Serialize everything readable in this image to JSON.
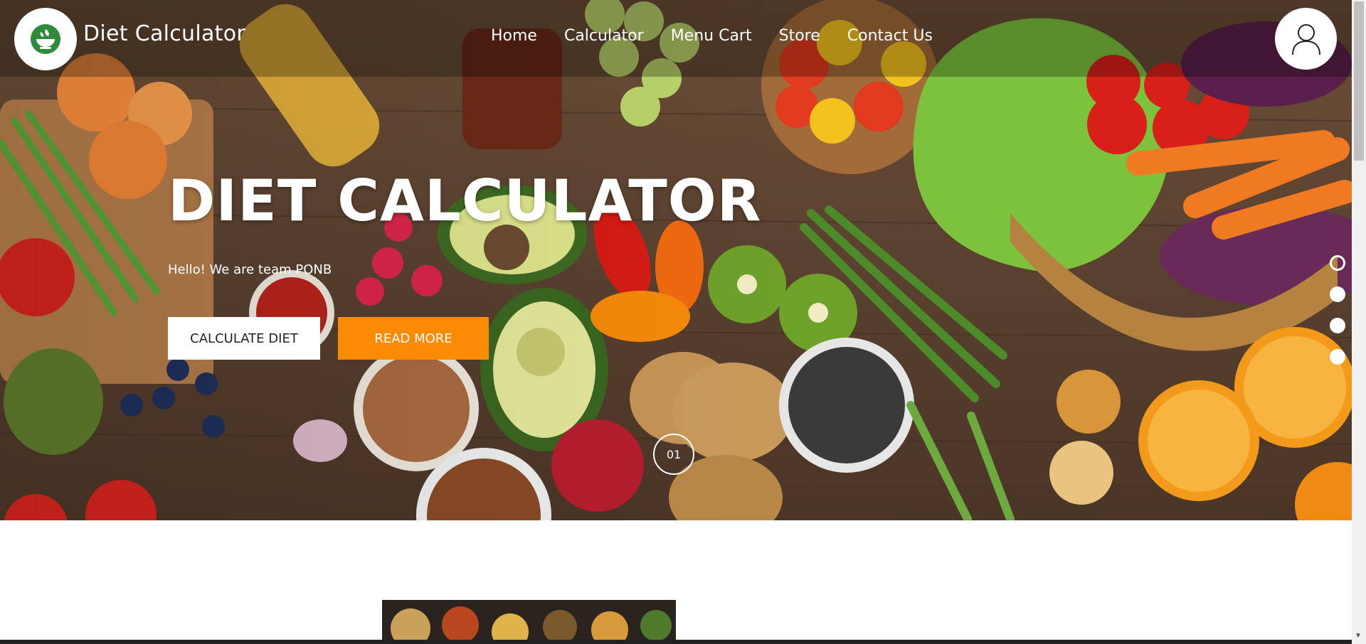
{
  "brand": {
    "name": "Diet Calculator",
    "logo_icon": "salad-bowl-icon"
  },
  "nav": {
    "items": [
      {
        "label": "Home"
      },
      {
        "label": "Calculator"
      },
      {
        "label": "Menu Cart"
      },
      {
        "label": "Store"
      },
      {
        "label": "Contact Us"
      }
    ]
  },
  "user": {
    "icon": "user-icon"
  },
  "hero": {
    "title": "DIET CALCULATOR",
    "subtitle": "Hello! We are team PONB",
    "primary_button": "CALCULATE DIET",
    "secondary_button": "READ MORE",
    "slide_number": "01",
    "slide_count": 4,
    "active_slide": 1
  },
  "colors": {
    "accent": "#fb8a05",
    "text_on_hero": "#ffffff",
    "brand_green": "#2f8a3a"
  }
}
